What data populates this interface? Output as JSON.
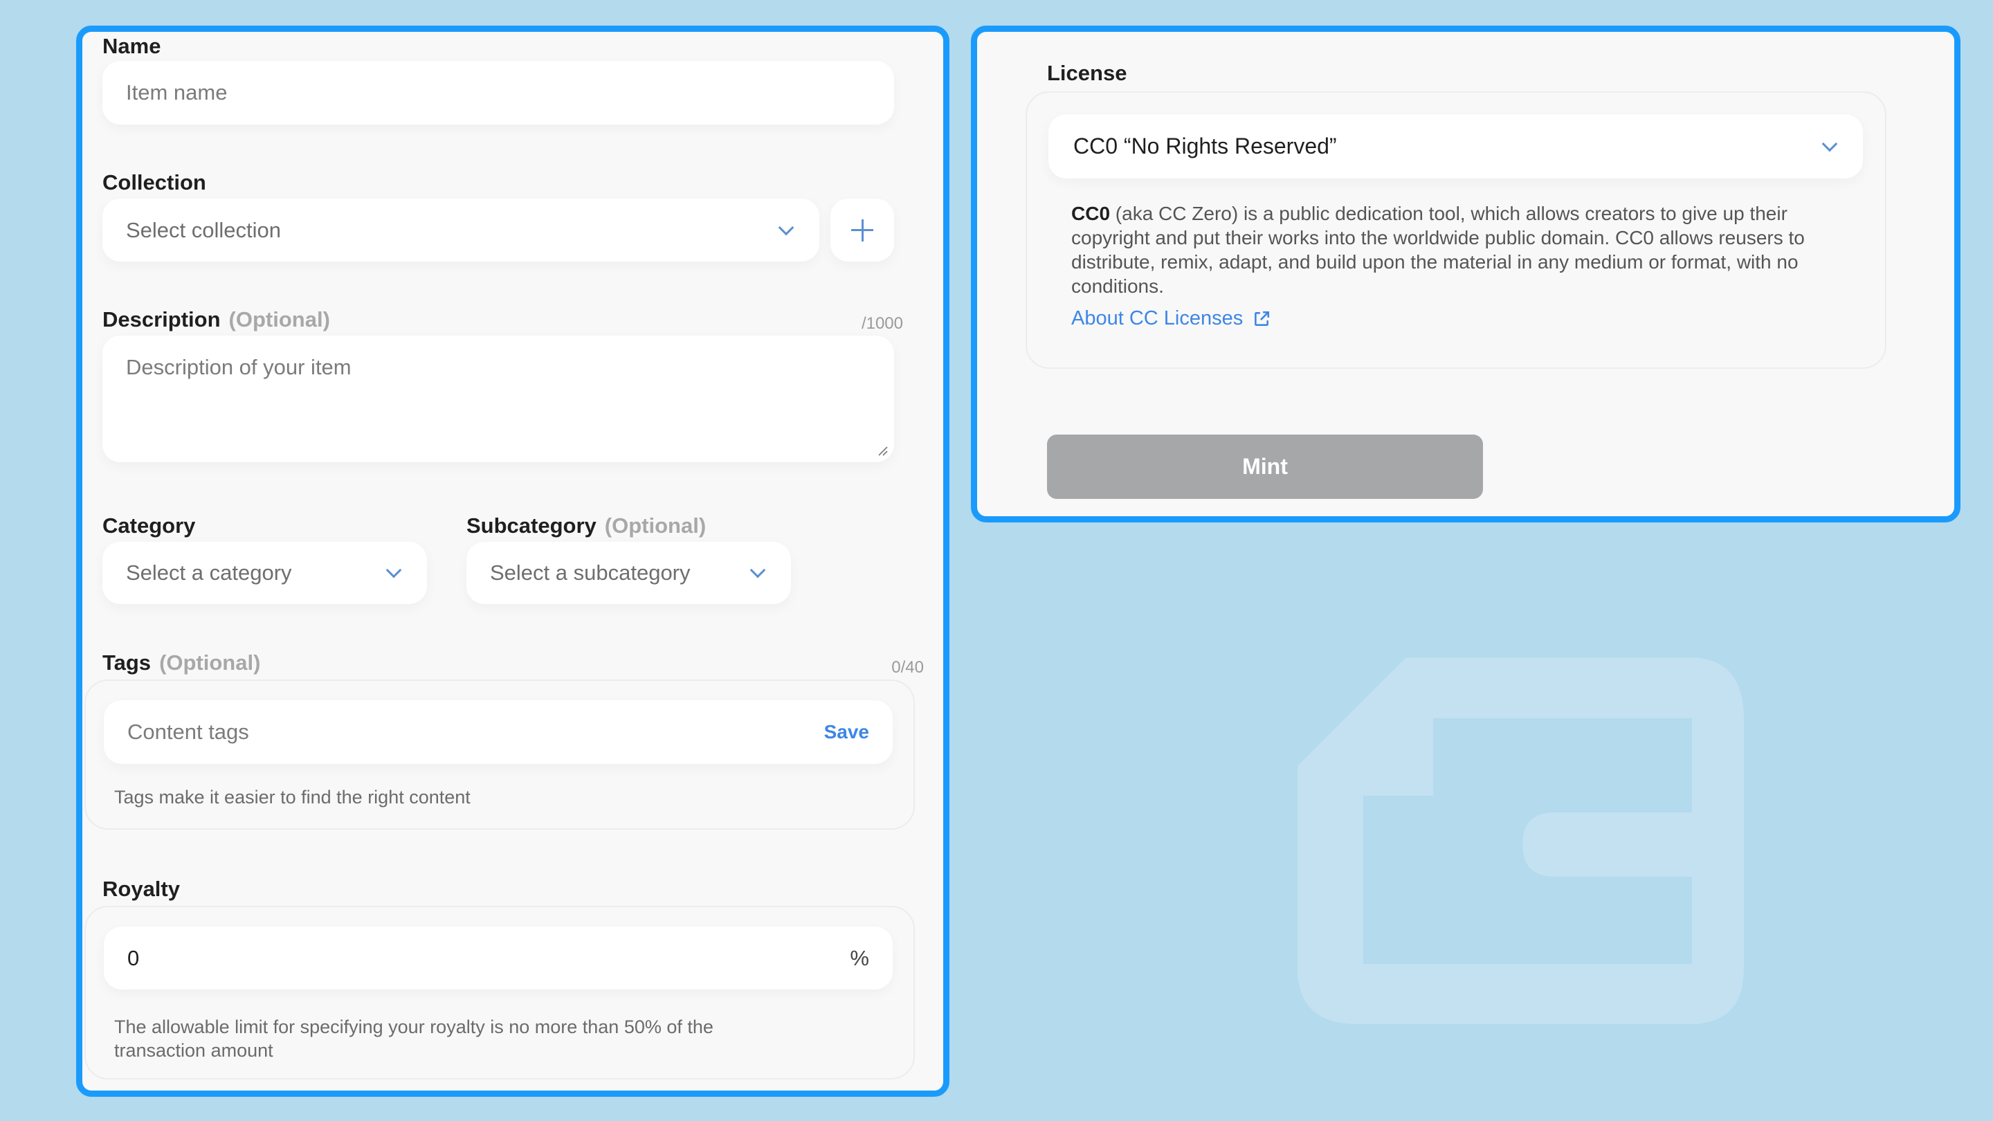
{
  "form": {
    "name": {
      "label": "Name",
      "placeholder": "Item name"
    },
    "collection": {
      "label": "Collection",
      "placeholder": "Select collection",
      "add_icon": "plus-icon"
    },
    "description": {
      "label": "Description",
      "optional": "(Optional)",
      "counter": "/1000",
      "placeholder": "Description of your item"
    },
    "category": {
      "label": "Category",
      "placeholder": "Select a category"
    },
    "subcategory": {
      "label": "Subcategory",
      "optional": "(Optional)",
      "placeholder": "Select a subcategory"
    },
    "tags": {
      "label": "Tags",
      "optional": "(Optional)",
      "counter": "0/40",
      "placeholder": "Content tags",
      "save_label": "Save",
      "helper": "Tags make it easier to find the right content"
    },
    "royalty": {
      "label": "Royalty",
      "value": "0",
      "suffix": "%",
      "helper": "The allowable limit for specifying your royalty is no more than 50% of the transaction amount"
    }
  },
  "license": {
    "label": "License",
    "selected": "CC0 “No Rights Reserved”",
    "desc_bold": "CC0",
    "desc_rest": " (aka CC Zero) is a public dedication tool, which allows creators to give up their copyright and put their works into the worldwide public domain. CC0 allows reusers to distribute, remix, adapt, and build upon the material in any medium or format, with no conditions.",
    "link_label": "About CC Licenses",
    "link_icon": "external-link-icon"
  },
  "actions": {
    "mint_label": "Mint"
  },
  "colors": {
    "accent_border": "#1a9bfc",
    "link": "#3d86e6",
    "icon": "#5b8fd1",
    "disabled_button": "#a6a7a9",
    "background": "#b3daed"
  }
}
